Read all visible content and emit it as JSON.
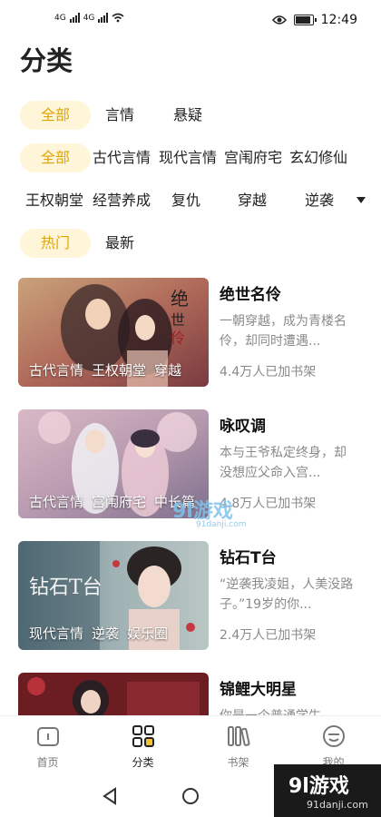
{
  "status_bar": {
    "signal_left": "4G",
    "signal_right": "4G",
    "time": "12:49"
  },
  "page": {
    "title": "分类"
  },
  "filters": {
    "row1": [
      "全部",
      "言情",
      "悬疑"
    ],
    "row2": [
      "全部",
      "古代言情",
      "现代言情",
      "宫闱府宅",
      "玄幻修仙"
    ],
    "row3": [
      "王权朝堂",
      "经营养成",
      "复仇",
      "穿越",
      "逆袭"
    ],
    "row4": [
      "热门",
      "最新"
    ]
  },
  "books": [
    {
      "title": "绝世名伶",
      "desc": "一朝穿越，成为青楼名伶，却同时遭遇...",
      "count": "4.4万人已加书架",
      "tags": [
        "古代言情",
        "王权朝堂",
        "穿越"
      ]
    },
    {
      "title": "咏叹调",
      "desc": "本与王爷私定终身，却没想应父命入宫...",
      "count": "4.8万人已加书架",
      "tags": [
        "古代言情",
        "宫闱府宅",
        "中长篇"
      ]
    },
    {
      "title": "钻石T台",
      "desc": "“逆袭我凌姐，人美没路子。”19岁的你...",
      "count": "2.4万人已加书架",
      "tags": [
        "现代言情",
        "逆袭",
        "娱乐圈"
      ]
    },
    {
      "title": "锦鲤大明星",
      "desc": "你是一个普通学生",
      "count": "",
      "tags": []
    }
  ],
  "tabbar": {
    "tabs": [
      "首页",
      "分类",
      "书架",
      "我的"
    ],
    "active_index": 1
  },
  "watermark": {
    "big": "9l游戏",
    "small": "91danji.com",
    "mid": "9l游戏",
    "mid_small": "91danji.com"
  },
  "colors": {
    "accent": "#e0a400",
    "chip_bg": "#fff6d9"
  }
}
